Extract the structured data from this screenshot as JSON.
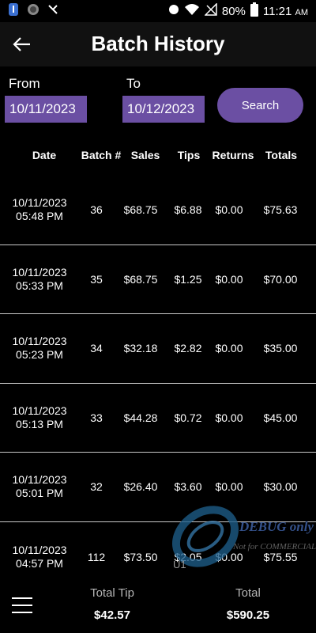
{
  "status_bar": {
    "battery": "80%",
    "time": "11:21",
    "ampm": "AM"
  },
  "header": {
    "title": "Batch History"
  },
  "filters": {
    "from_label": "From",
    "from_value": "10/11/2023",
    "to_label": "To",
    "to_value": "10/12/2023",
    "search_label": "Search"
  },
  "table": {
    "columns": [
      "Date",
      "Batch #",
      "Sales",
      "Tips",
      "Returns",
      "Totals"
    ],
    "rows": [
      {
        "date": "10/11/2023",
        "time": "05:48 PM",
        "batch": "36",
        "sales": "$68.75",
        "tips": "$6.88",
        "returns": "$0.00",
        "totals": "$75.63"
      },
      {
        "date": "10/11/2023",
        "time": "05:33 PM",
        "batch": "35",
        "sales": "$68.75",
        "tips": "$1.25",
        "returns": "$0.00",
        "totals": "$70.00"
      },
      {
        "date": "10/11/2023",
        "time": "05:23 PM",
        "batch": "34",
        "sales": "$32.18",
        "tips": "$2.82",
        "returns": "$0.00",
        "totals": "$35.00"
      },
      {
        "date": "10/11/2023",
        "time": "05:13 PM",
        "batch": "33",
        "sales": "$44.28",
        "tips": "$0.72",
        "returns": "$0.00",
        "totals": "$45.00"
      },
      {
        "date": "10/11/2023",
        "time": "05:01 PM",
        "batch": "32",
        "sales": "$26.40",
        "tips": "$3.60",
        "returns": "$0.00",
        "totals": "$30.00"
      },
      {
        "date": "10/11/2023",
        "time": "04:57 PM",
        "batch": "112",
        "sales": "$73.50",
        "tips": "$2.05",
        "returns": "$0.00",
        "totals": "$75.55"
      }
    ]
  },
  "footer": {
    "total_tip_label": "Total Tip",
    "total_tip_value": "$42.57",
    "total_label": "Total",
    "total_value": "$590.25"
  },
  "watermark": {
    "line1": "DEBUG only",
    "line2": "Not for COMMERCIAL",
    "partial": "U1"
  }
}
